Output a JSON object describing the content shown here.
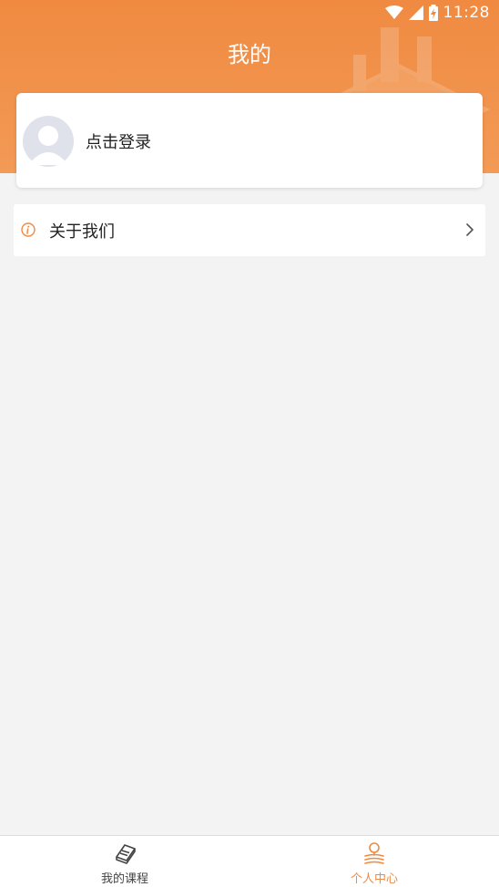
{
  "status_bar": {
    "time": "11:28",
    "icons": [
      "wifi-icon",
      "cell-signal-icon",
      "battery-charging-icon"
    ]
  },
  "header": {
    "title": "我的"
  },
  "profile": {
    "login_label": "点击登录",
    "avatar_icon": "default-avatar-icon"
  },
  "menu": {
    "items": [
      {
        "label": "关于我们",
        "icon": "info-icon",
        "trailing_icon": "chevron-right-icon"
      }
    ]
  },
  "tabbar": {
    "items": [
      {
        "label": "我的课程",
        "icon": "book-icon",
        "active": false
      },
      {
        "label": "个人中心",
        "icon": "person-reading-icon",
        "active": true
      }
    ]
  },
  "colors": {
    "brand": "#f08a41",
    "tab_active": "#f08a41",
    "tab_inactive": "#444444",
    "background": "#f3f3f3"
  }
}
